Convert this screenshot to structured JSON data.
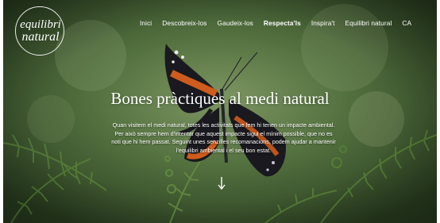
{
  "logo": {
    "line1": "equilibri",
    "line2": "natural"
  },
  "nav": {
    "items": [
      {
        "label": "Inici",
        "active": false
      },
      {
        "label": "Descobreix-los",
        "active": false
      },
      {
        "label": "Gaudeix-los",
        "active": false
      },
      {
        "label": "Respecta'ls",
        "active": true
      },
      {
        "label": "Inspira't",
        "active": false
      },
      {
        "label": "Equilibri natural",
        "active": false
      },
      {
        "label": "CA",
        "active": false
      }
    ]
  },
  "hero": {
    "title": "Bones pràctiques al medi natural",
    "intro": "Quan visitem el medi natural, totes les activitats que fem hi tenen un impacte ambiental. Per això sempre hem d'intentar que aquest impacte sigui el mínim possible, que no es noti que hi hem passat. Seguint unes senzilles recomanacions, podem ajudar a mantenir l'equilibri ambiental i el seu bon estat.",
    "scroll_icon": "arrow-down-icon"
  },
  "colors": {
    "text": "#ffffff",
    "butterfly_wing": "#1c1c22",
    "butterfly_band": "#e0641f"
  }
}
